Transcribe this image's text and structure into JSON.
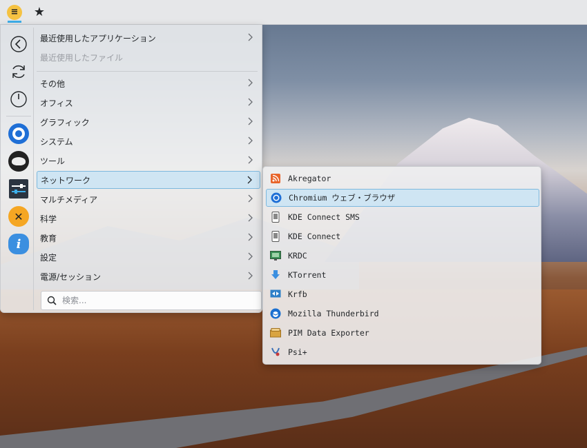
{
  "panel": {
    "launcher_icon": "hamburger-menu-icon",
    "favorite_icon": "star-icon"
  },
  "rail": {
    "actions": [
      {
        "name": "back-icon"
      },
      {
        "name": "refresh-icon"
      },
      {
        "name": "power-icon"
      }
    ],
    "favorites": [
      {
        "name": "chromium-icon",
        "color": "#1f6fd6"
      },
      {
        "name": "pidgin-icon",
        "color": "#222222"
      },
      {
        "name": "settings-sliders-icon",
        "color": "#2b3440"
      },
      {
        "name": "tools-icon",
        "color": "#f5a623"
      },
      {
        "name": "info-icon",
        "color": "#3b8fe0"
      }
    ]
  },
  "categories": [
    {
      "label": "最近使用したアプリケーション",
      "dim": false
    },
    {
      "label": "最近使用したファイル",
      "dim": true
    },
    {
      "label": "その他",
      "dim": false
    },
    {
      "label": "オフィス",
      "dim": false
    },
    {
      "label": "グラフィック",
      "dim": false
    },
    {
      "label": "システム",
      "dim": false
    },
    {
      "label": "ツール",
      "dim": false
    },
    {
      "label": "ネットワーク",
      "dim": false,
      "active": true
    },
    {
      "label": "マルチメディア",
      "dim": false
    },
    {
      "label": "科学",
      "dim": false
    },
    {
      "label": "教育",
      "dim": false
    },
    {
      "label": "設定",
      "dim": false
    },
    {
      "label": "電源/セッション",
      "dim": false
    }
  ],
  "search": {
    "placeholder": "検索...",
    "value": ""
  },
  "submenu": {
    "items": [
      {
        "label": "Akregator",
        "icon": "rss-icon",
        "color": "#e8642a"
      },
      {
        "label": "Chromium ウェブ・ブラウザ",
        "icon": "chromium-icon",
        "color": "#1f6fd6",
        "active": true
      },
      {
        "label": "KDE Connect SMS",
        "icon": "phone-icon",
        "color": "#555555"
      },
      {
        "label": "KDE Connect",
        "icon": "phone-icon",
        "color": "#555555"
      },
      {
        "label": "KRDC",
        "icon": "remote-desktop-icon",
        "color": "#3a8f56"
      },
      {
        "label": "KTorrent",
        "icon": "download-arrow-icon",
        "color": "#3b8fe0"
      },
      {
        "label": "Krfb",
        "icon": "desktop-sharing-icon",
        "color": "#2d7fc8"
      },
      {
        "label": "Mozilla Thunderbird",
        "icon": "thunderbird-icon",
        "color": "#1a6fd0"
      },
      {
        "label": "PIM Data Exporter",
        "icon": "archive-icon",
        "color": "#d9a441"
      },
      {
        "label": "Psi+",
        "icon": "psi-icon",
        "color": "#c83a3a"
      }
    ]
  },
  "colors": {
    "accent": "#3daee9",
    "selection_bg": "#cfe5f3",
    "selection_border": "#7cb8de"
  }
}
